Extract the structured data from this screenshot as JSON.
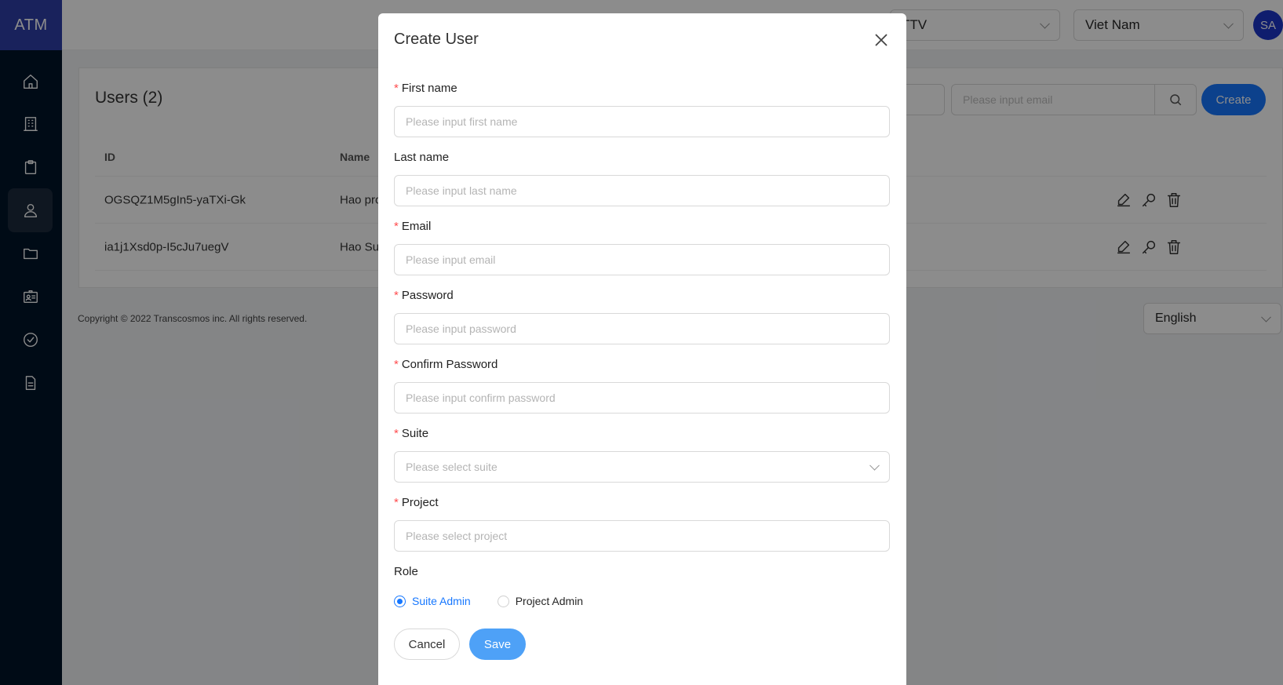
{
  "app": {
    "logo": "ATM"
  },
  "sidebar": {
    "items": [
      {
        "icon": "home-icon"
      },
      {
        "icon": "building-icon"
      },
      {
        "icon": "clipboard-icon"
      },
      {
        "icon": "user-icon",
        "active": true
      },
      {
        "icon": "folder-icon"
      },
      {
        "icon": "id-card-icon"
      },
      {
        "icon": "check-circle-icon"
      },
      {
        "icon": "document-icon"
      }
    ]
  },
  "header": {
    "suite_select": "TTV",
    "country_select": "Viet Nam",
    "avatar_initials": "SA"
  },
  "users_page": {
    "title": "Users (2)",
    "email_search_placeholder": "Please input email",
    "create_label": "Create",
    "columns": [
      "ID",
      "Name"
    ],
    "rows": [
      {
        "id": "OGSQZ1M5gIn5-yaTXi-Gk",
        "name": "Hao proj"
      },
      {
        "id": "ia1j1Xsd0p-I5cJu7uegV",
        "name": "Hao Sui"
      }
    ]
  },
  "footer": {
    "copyright": "Copyright © 2022 Transcosmos inc. All rights reserved.",
    "language": "English"
  },
  "modal": {
    "title": "Create User",
    "fields": {
      "first_name": {
        "label": "First name",
        "required": true,
        "placeholder": "Please input first name"
      },
      "last_name": {
        "label": "Last name",
        "required": false,
        "placeholder": "Please input last name"
      },
      "email": {
        "label": "Email",
        "required": true,
        "placeholder": "Please input email"
      },
      "password": {
        "label": "Password",
        "required": true,
        "placeholder": "Please input password"
      },
      "confirm_password": {
        "label": "Confirm Password",
        "required": true,
        "placeholder": "Please input confirm password"
      },
      "suite": {
        "label": "Suite",
        "required": true,
        "placeholder": "Please select suite"
      },
      "project": {
        "label": "Project",
        "required": true,
        "placeholder": "Please select project"
      }
    },
    "role": {
      "label": "Role",
      "options": [
        "Suite Admin",
        "Project Admin"
      ],
      "selected": "Suite Admin"
    },
    "cancel_label": "Cancel",
    "save_label": "Save"
  },
  "colors": {
    "sidebar_bg": "#001529",
    "logo_bg": "#2f3ea8",
    "primary": "#1677ff",
    "required_mark": "#ff4d4f"
  }
}
